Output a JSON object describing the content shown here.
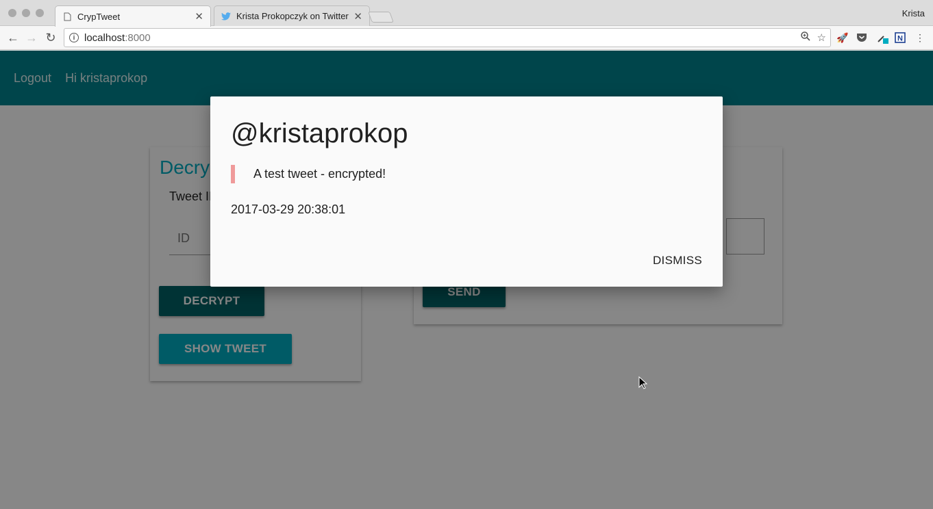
{
  "browser": {
    "tabs": [
      {
        "title": "CrypTweet",
        "active": true
      },
      {
        "title": "Krista Prokopczyk on Twitter: \"",
        "active": false
      }
    ],
    "profile_name": "Krista",
    "address": {
      "host": "localhost",
      "port": ":8000"
    }
  },
  "appbar": {
    "logout_label": "Logout",
    "greeting": "Hi kristaprokop",
    "color": "#00838f"
  },
  "decrypt_card": {
    "title": "Decrypt",
    "tweet_id_label": "Tweet ID",
    "id_placeholder": "ID",
    "decrypt_button": "DECRYPT",
    "show_tweet_button": "SHOW TWEET"
  },
  "send_card": {
    "send_button": "SEND"
  },
  "modal": {
    "title": "@kristaprokop",
    "tweet_text": "A test tweet - encrypted!",
    "timestamp": "2017-03-29 20:38:01",
    "dismiss_label": "DISMISS",
    "quote_color": "#ef9a9a"
  }
}
